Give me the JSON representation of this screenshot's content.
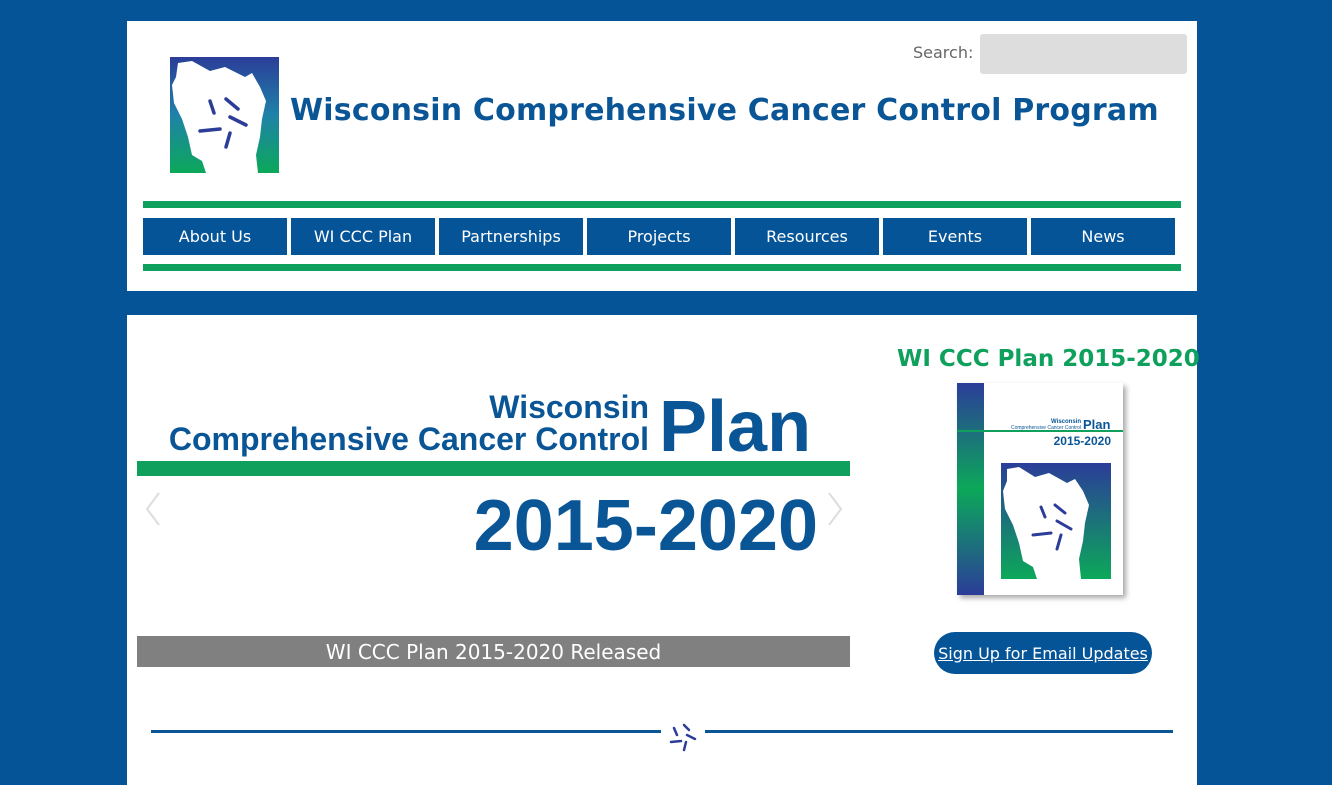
{
  "header": {
    "title": "Wisconsin Comprehensive Cancer Control Program",
    "logo_icon": "wisconsin-map-logo-icon",
    "search": {
      "label": "Search:",
      "value": "",
      "placeholder": ""
    }
  },
  "nav": {
    "items": [
      {
        "label": "About Us"
      },
      {
        "label": "WI CCC Plan"
      },
      {
        "label": "Partnerships"
      },
      {
        "label": "Projects"
      },
      {
        "label": "Resources"
      },
      {
        "label": "Events"
      },
      {
        "label": "News"
      }
    ]
  },
  "slider": {
    "banner": {
      "line1": "Wisconsin",
      "line2": "Comprehensive Cancer Control",
      "word": "Plan",
      "years": "2015-2020"
    },
    "caption": "WI CCC Plan 2015-2020 Released",
    "prev_icon": "chevron-left-icon",
    "next_icon": "chevron-right-icon"
  },
  "sidebar": {
    "title": "WI CCC Plan 2015-2020",
    "cover": {
      "line1": "Wisconsin",
      "line2": "Comprehensive Cancer Control",
      "word": "Plan",
      "years": "2015-2020"
    },
    "signup_label": "Sign Up for Email Updates"
  },
  "colors": {
    "brand_blue": "#055497",
    "brand_green": "#0ea05c",
    "caption_gray": "#808080"
  }
}
